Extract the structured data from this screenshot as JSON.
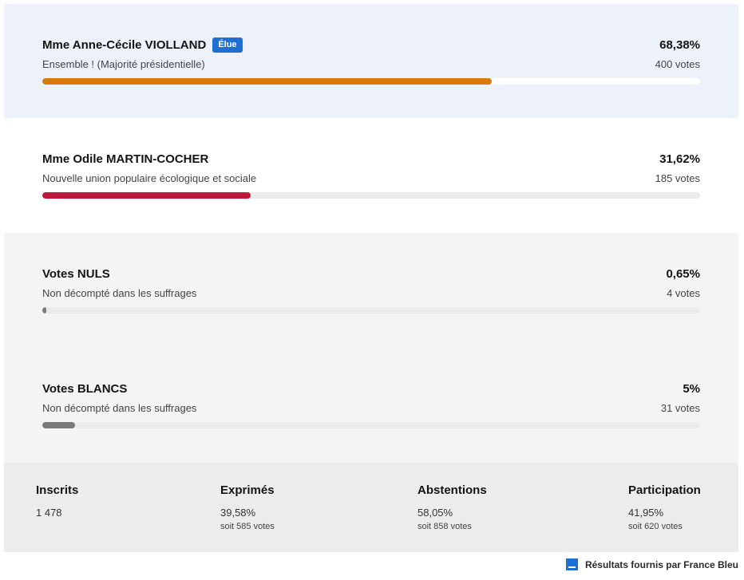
{
  "candidates": [
    {
      "name": "Mme Anne-Cécile VIOLLAND",
      "badge": "Élue",
      "party": "Ensemble ! (Majorité présidentielle)",
      "percent_label": "68,38%",
      "votes_label": "400 votes",
      "share": 68.38,
      "bar_color": "#d97a0b"
    },
    {
      "name": "Mme Odile MARTIN-COCHER",
      "party": "Nouvelle union populaire écologique et sociale",
      "percent_label": "31,62%",
      "votes_label": "185 votes",
      "share": 31.62,
      "bar_color": "#c0183a"
    },
    {
      "name": "Votes NULS",
      "party": "Non décompté dans les suffrages",
      "percent_label": "0,65%",
      "votes_label": "4 votes",
      "share": 0.65,
      "bar_color": "#7a7a7a"
    },
    {
      "name": "Votes BLANCS",
      "party": "Non décompté dans les suffrages",
      "percent_label": "5%",
      "votes_label": "31 votes",
      "share": 5,
      "bar_color": "#7a7a7a"
    }
  ],
  "summary": {
    "inscrits": {
      "label": "Inscrits",
      "value": "1 478"
    },
    "exprimes": {
      "label": "Exprimés",
      "value": "39,58%",
      "sub": "soit 585 votes"
    },
    "abstentions": {
      "label": "Abstentions",
      "value": "58,05%",
      "sub": "soit 858 votes"
    },
    "participation": {
      "label": "Participation",
      "value": "41,95%",
      "sub": "soit 620 votes"
    }
  },
  "footer": {
    "credit": "Résultats fournis par France Bleu",
    "logo_icon": "france-bleu-logo-icon",
    "logo_color": "#1d6fd1"
  }
}
